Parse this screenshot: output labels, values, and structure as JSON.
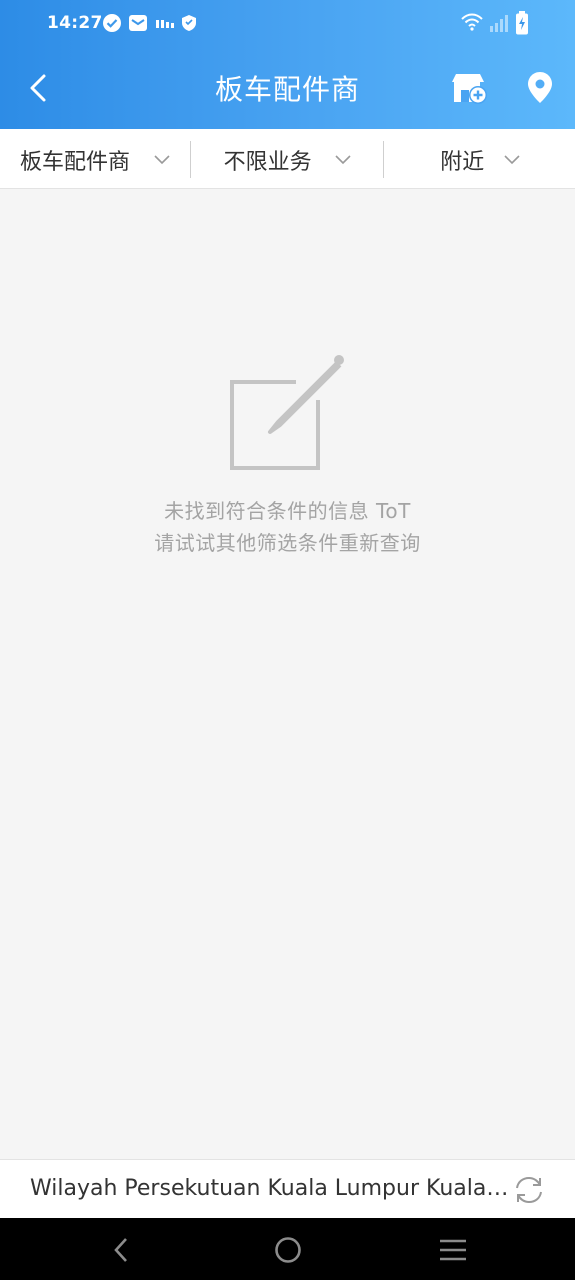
{
  "status_bar": {
    "time": "14:27",
    "icons": [
      "check-circle-icon",
      "mail-icon",
      "signal-label-icon",
      "shield-icon",
      "wifi-icon",
      "cellular-signal-icon",
      "battery-charging-icon"
    ]
  },
  "header": {
    "title": "板车配件商",
    "back_icon": "chevron-left-icon",
    "add_shop_icon": "shop-add-icon",
    "location_icon": "map-pin-icon",
    "gradient_start": "#2d8ce6",
    "gradient_end": "#5cb8fb"
  },
  "filters": [
    {
      "label": "板车配件商",
      "icon": "chevron-down-icon"
    },
    {
      "label": "不限业务",
      "icon": "chevron-down-icon"
    },
    {
      "label": "附近",
      "icon": "chevron-down-icon"
    }
  ],
  "empty_state": {
    "icon": "edit-note-icon",
    "line1": "未找到符合条件的信息 ToT",
    "line2": "请试试其他筛选条件重新查询"
  },
  "location_bar": {
    "text": "Wilayah Persekutuan Kuala Lumpur Kuala Lumpur",
    "refresh_icon": "refresh-icon"
  },
  "nav_bar": {
    "icons": [
      "nav-back-icon",
      "nav-home-icon",
      "nav-menu-icon"
    ]
  }
}
